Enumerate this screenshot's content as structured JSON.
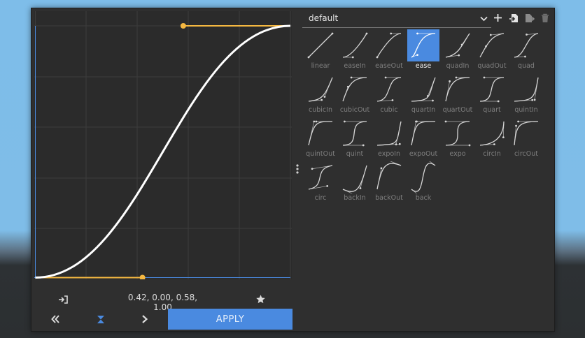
{
  "editor": {
    "coordinates": "0.42, 0.00, 0.58, 1.00",
    "apply_label": "APPLY",
    "accent_color": "#4a8ae0",
    "handle_color": "#f5b841",
    "curve_color": "#ffffff",
    "control_points": [
      0.42,
      0.0,
      0.58,
      1.0
    ]
  },
  "presets": {
    "selected_preset": "default",
    "selected_item": "ease",
    "items": [
      {
        "label": "linear",
        "p": [
          0,
          0,
          1,
          1
        ]
      },
      {
        "label": "easeIn",
        "p": [
          0.42,
          0,
          1,
          1
        ]
      },
      {
        "label": "easeOut",
        "p": [
          0,
          0,
          0.58,
          1
        ]
      },
      {
        "label": "ease",
        "p": [
          0.25,
          0.1,
          0.25,
          1
        ]
      },
      {
        "label": "quadIn",
        "p": [
          0.55,
          0.085,
          0.68,
          0.53
        ]
      },
      {
        "label": "quadOut",
        "p": [
          0.25,
          0.46,
          0.45,
          0.94
        ]
      },
      {
        "label": "quad",
        "p": [
          0.455,
          0.03,
          0.515,
          0.955
        ]
      },
      {
        "label": "cubicIn",
        "p": [
          0.55,
          0.055,
          0.675,
          0.19
        ]
      },
      {
        "label": "cubicOut",
        "p": [
          0.215,
          0.61,
          0.355,
          1
        ]
      },
      {
        "label": "cubic",
        "p": [
          0.645,
          0.045,
          0.355,
          1
        ]
      },
      {
        "label": "quartIn",
        "p": [
          0.895,
          0.03,
          0.685,
          0.22
        ]
      },
      {
        "label": "quartOut",
        "p": [
          0.165,
          0.84,
          0.44,
          1
        ]
      },
      {
        "label": "quart",
        "p": [
          0.77,
          0,
          0.175,
          1
        ]
      },
      {
        "label": "quintIn",
        "p": [
          0.755,
          0.05,
          0.855,
          0.06
        ]
      },
      {
        "label": "quintOut",
        "p": [
          0.23,
          1,
          0.32,
          1
        ]
      },
      {
        "label": "quint",
        "p": [
          0.86,
          0,
          0.07,
          1
        ]
      },
      {
        "label": "expoIn",
        "p": [
          0.95,
          0.05,
          0.795,
          0.035
        ]
      },
      {
        "label": "expoOut",
        "p": [
          0.19,
          1,
          0.22,
          1
        ]
      },
      {
        "label": "expo",
        "p": [
          1,
          0,
          0,
          1
        ]
      },
      {
        "label": "circIn",
        "p": [
          0.6,
          0.04,
          0.98,
          0.335
        ]
      },
      {
        "label": "circOut",
        "p": [
          0.075,
          0.82,
          0.165,
          1
        ]
      },
      {
        "label": "circ",
        "p": [
          0.785,
          0.135,
          0.15,
          0.86
        ]
      },
      {
        "label": "backIn",
        "p": [
          0.6,
          -0.28,
          0.735,
          0.045
        ]
      },
      {
        "label": "backOut",
        "p": [
          0.175,
          0.885,
          0.32,
          1.275
        ]
      },
      {
        "label": "back",
        "p": [
          0.68,
          -0.55,
          0.265,
          1.55
        ]
      }
    ]
  },
  "icons": {
    "add": "plus-icon",
    "import": "import-icon",
    "export": "export-icon",
    "delete": "trash-icon",
    "dropdown": "chevron-down-icon",
    "copy_in": "paste-in-icon",
    "favorite": "star-icon",
    "prev": "chevron-double-left-icon",
    "center": "hourglass-icon",
    "next": "chevron-right-icon",
    "drag": "drag-handle-icon"
  }
}
